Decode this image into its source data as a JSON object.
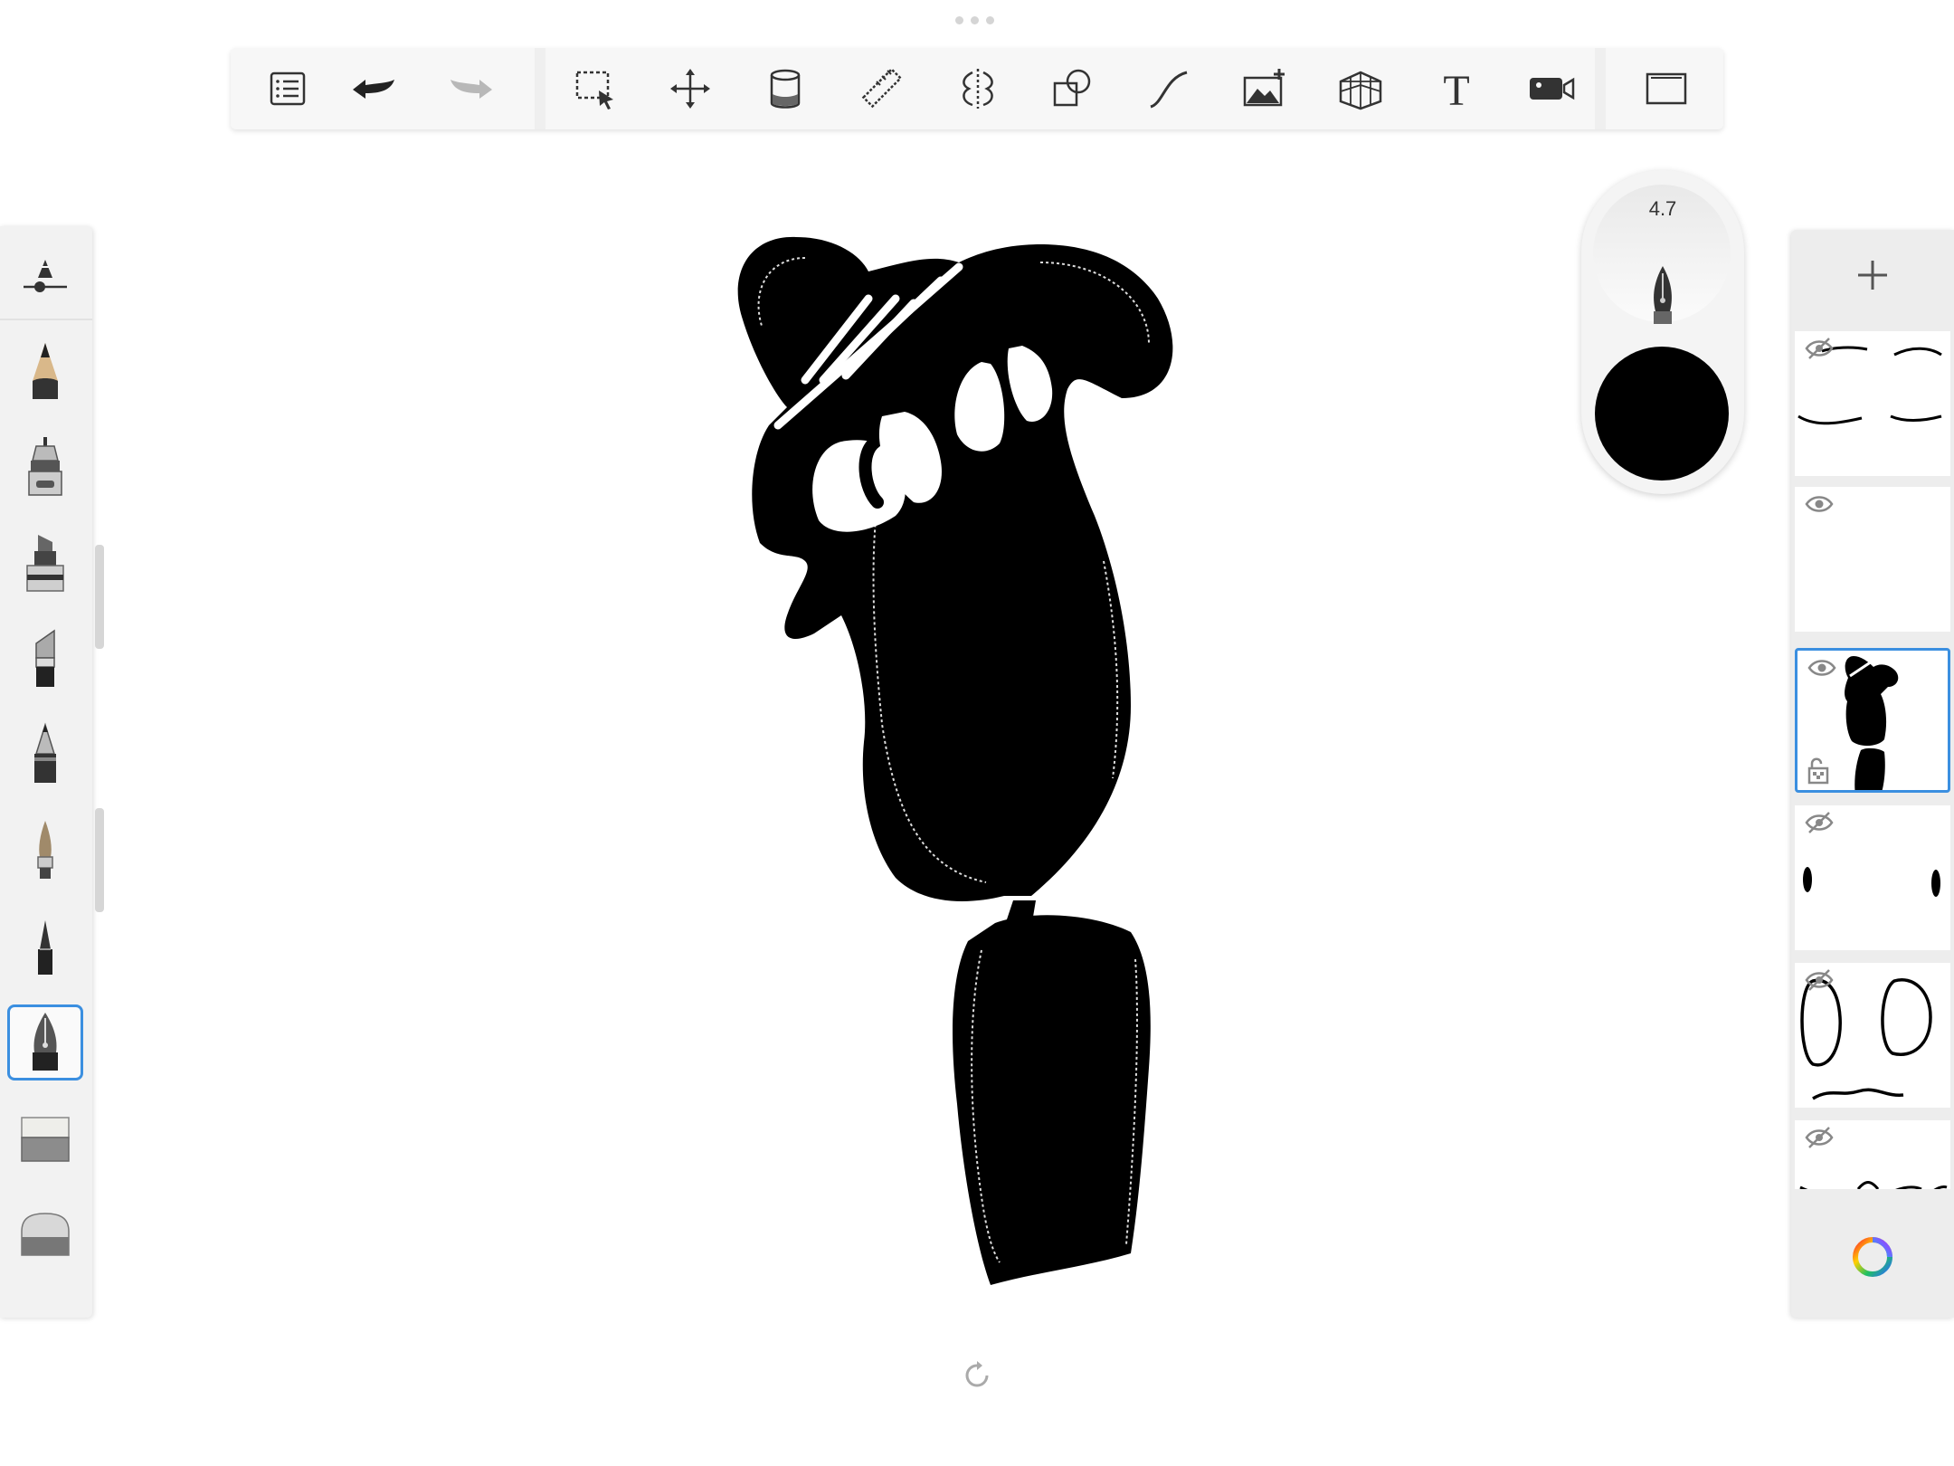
{
  "app": {
    "accent_color": "#3b8fe0",
    "active_color": "#000000"
  },
  "toolbar": {
    "left_group": [
      {
        "name": "list-icon"
      },
      {
        "name": "undo-icon"
      },
      {
        "name": "redo-icon"
      }
    ],
    "tools": [
      {
        "name": "selection-icon"
      },
      {
        "name": "transform-icon"
      },
      {
        "name": "fill-icon"
      },
      {
        "name": "ruler-icon"
      },
      {
        "name": "symmetry-icon"
      },
      {
        "name": "shapes-icon"
      },
      {
        "name": "curve-icon"
      },
      {
        "name": "image-add-icon"
      },
      {
        "name": "perspective-icon"
      },
      {
        "name": "text-icon",
        "glyph": "T"
      },
      {
        "name": "record-icon"
      }
    ],
    "right_group": [
      {
        "name": "fullscreen-icon"
      }
    ]
  },
  "brush_panel": {
    "top_tool": "brush-settings-icon",
    "brushes": [
      {
        "name": "pencil"
      },
      {
        "name": "technical-pen"
      },
      {
        "name": "marker"
      },
      {
        "name": "chisel-marker"
      },
      {
        "name": "ballpoint-pen"
      },
      {
        "name": "paint-brush"
      },
      {
        "name": "fine-liner"
      },
      {
        "name": "fountain-pen",
        "selected": true
      },
      {
        "name": "soft-eraser"
      },
      {
        "name": "hard-eraser"
      }
    ]
  },
  "puck": {
    "size_value": "4.7",
    "color": "#000000"
  },
  "layers": {
    "items": [
      {
        "name": "layer-1",
        "visible": false,
        "selected": false
      },
      {
        "name": "layer-2",
        "visible": true,
        "selected": false
      },
      {
        "name": "layer-3",
        "visible": true,
        "selected": true
      },
      {
        "name": "layer-4",
        "visible": false,
        "selected": false
      },
      {
        "name": "layer-5",
        "visible": false,
        "selected": false
      },
      {
        "name": "layer-6",
        "visible": false,
        "selected": false
      }
    ]
  }
}
